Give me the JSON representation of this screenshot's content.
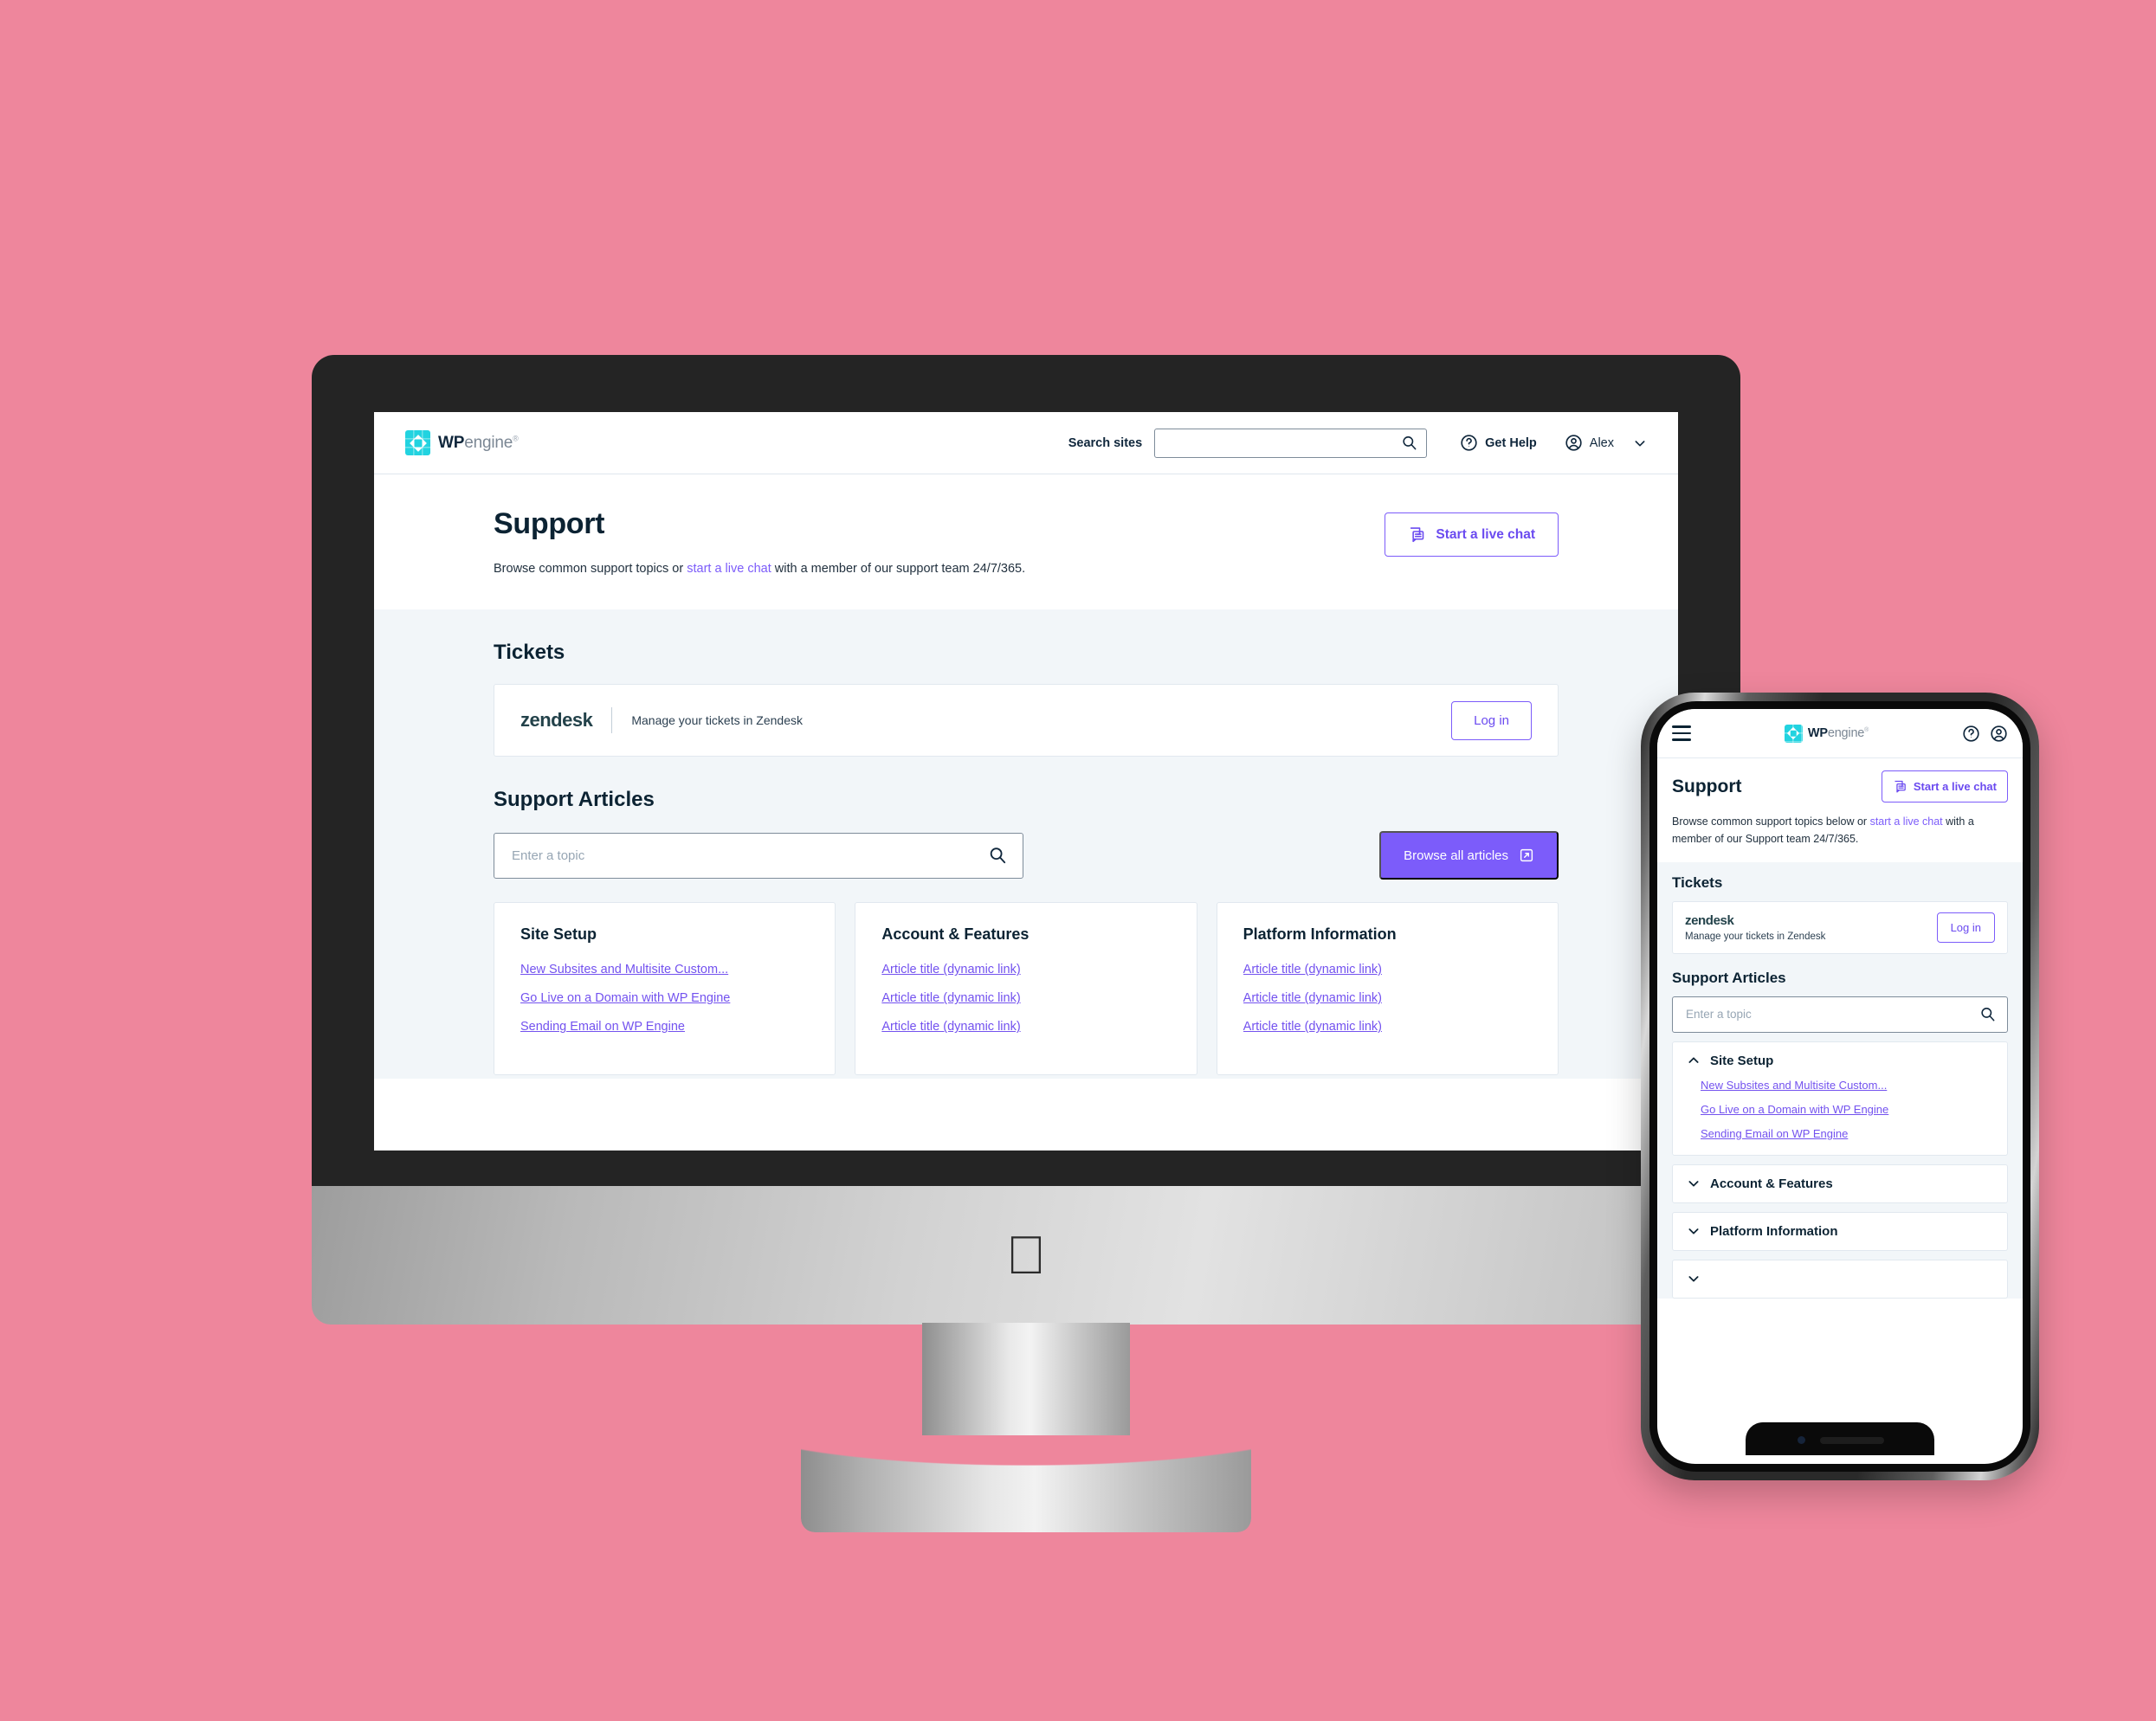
{
  "theme": {
    "background": "#ee869c",
    "accent_purple": "#7c5cfa",
    "link_purple": "#7352ef",
    "dark_navy": "#0c2333",
    "panel_gray": "#f2f6f9",
    "brand_cyan": "#22d3e0"
  },
  "brand": {
    "wp": "WP",
    "engine": "engine",
    "trademark": "®"
  },
  "desktop": {
    "topbar": {
      "search_label": "Search sites",
      "search_value": "",
      "search_placeholder": "",
      "help_label": "Get Help",
      "user_name": "Alex"
    },
    "hero": {
      "title": "Support",
      "desc_before": "Browse common support topics or ",
      "desc_link": "start a live chat",
      "desc_after": " with a member of our support team 24/7/365.",
      "chat_button": "Start a live chat"
    },
    "tickets": {
      "heading": "Tickets",
      "zendesk_logo": "zendesk",
      "zendesk_text": "Manage your tickets in Zendesk",
      "login_button": "Log in"
    },
    "articles": {
      "heading": "Support Articles",
      "search_value": "",
      "search_placeholder": "Enter a topic",
      "browse_button": "Browse all articles",
      "columns": [
        {
          "title": "Site Setup",
          "links": [
            "New Subsites and Multisite Custom...",
            "Go Live on a Domain with WP Engine",
            "Sending Email on WP Engine"
          ]
        },
        {
          "title": "Account & Features",
          "links": [
            "Article title (dynamic link)",
            "Article title (dynamic link)",
            "Article title (dynamic link)"
          ]
        },
        {
          "title": "Platform Information",
          "links": [
            "Article title (dynamic link)",
            "Article title (dynamic link)",
            "Article title (dynamic link)"
          ]
        }
      ]
    }
  },
  "mobile": {
    "hero": {
      "title": "Support",
      "chat_button": "Start a live chat",
      "desc_before": "Browse common support topics below or ",
      "desc_link": "start a live chat",
      "desc_after": " with a member of our Support team 24/7/365."
    },
    "tickets": {
      "heading": "Tickets",
      "zendesk_logo": "zendesk",
      "zendesk_text": "Manage your tickets in Zendesk",
      "login_button": "Log in"
    },
    "articles": {
      "heading": "Support Articles",
      "search_value": "",
      "search_placeholder": "Enter a topic",
      "accordions": [
        {
          "title": "Site Setup",
          "expanded": true,
          "links": [
            "New Subsites and Multisite Custom...",
            "Go Live on a Domain with WP Engine",
            "Sending Email on WP Engine"
          ]
        },
        {
          "title": "Account & Features",
          "expanded": false,
          "links": []
        },
        {
          "title": "Platform Information",
          "expanded": false,
          "links": []
        }
      ]
    }
  }
}
